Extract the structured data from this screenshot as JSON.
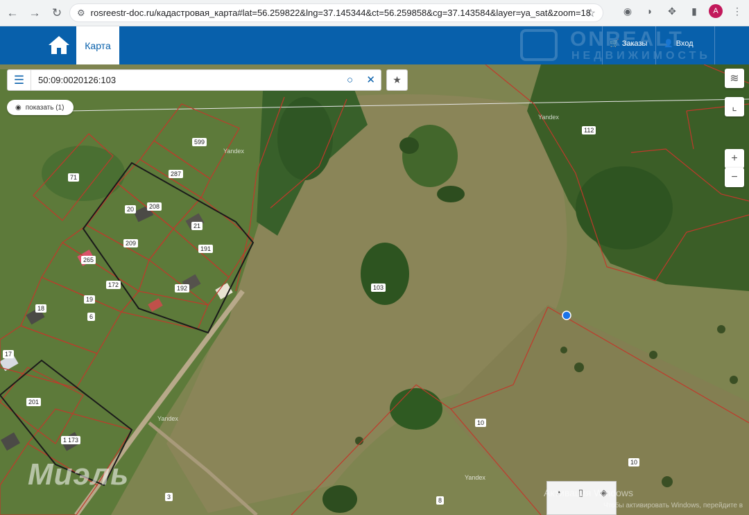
{
  "browser": {
    "url": "rosreestr-doc.ru/кадастровая_карта#lat=56.259822&lng=37.145344&ct=56.259858&cg=37.143584&layer=ya_sat&zoom=18",
    "profile_initial": "A"
  },
  "header": {
    "map_tab": "Карта",
    "orders": "Заказы",
    "login": "Вход",
    "watermark_top": "ONREALT",
    "watermark_sub": "НЕДВИЖИМОСТЬ"
  },
  "search": {
    "value": "50:09:0020126:103"
  },
  "show_button": "показать (1)",
  "controls": {
    "zoom_in": "+",
    "zoom_out": "−"
  },
  "plots": [
    "599",
    "287",
    "71",
    "20",
    "208",
    "21",
    "191",
    "209",
    "265",
    "172",
    "192",
    "19",
    "18",
    "6",
    "17",
    "201",
    "173",
    "1",
    "3",
    "103",
    "112",
    "10",
    "10",
    "8"
  ],
  "yandex_labels": [
    "Yandex",
    "Yandex",
    "Yandex",
    "Yandex"
  ],
  "bottom_watermark": "Миэль",
  "activation": {
    "line1": "Активация Windows",
    "line2": "Чтобы активировать Windows, перейдите в"
  },
  "colors": {
    "header_blue": "#0860ab",
    "plot_line": "#c0392b"
  }
}
